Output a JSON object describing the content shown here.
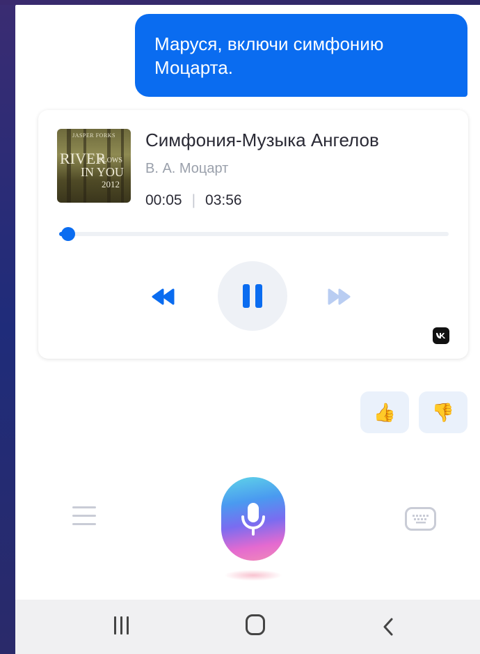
{
  "chat": {
    "user_message": {
      "line1": "Маруся, включи симфонию",
      "line2": "Моцарта."
    }
  },
  "player": {
    "cover_art": {
      "label_top": "JASPER FORKS",
      "word_river": "RIVER",
      "word_flows": "FLOWS",
      "word_in_you": "IN YOU",
      "year": "2012"
    },
    "title": "Симфония-Музыка Ангелов",
    "artist": "В. А. Моцарт",
    "elapsed": "00:05",
    "separator": "|",
    "duration": "03:56",
    "progress": 0.02,
    "state": "playing",
    "source_badge": "vk"
  },
  "feedback": {
    "like_emoji": "👍",
    "dislike_emoji": "👎"
  },
  "bottom_bar": {
    "menu_icon": "menu-icon",
    "mic_icon": "microphone-icon",
    "keyboard_icon": "keyboard-icon"
  },
  "system_nav": {
    "recents_icon": "recents-icon",
    "home_icon": "home-icon",
    "back_icon": "back-icon"
  },
  "colors": {
    "accent": "#0a6cf0",
    "text_primary": "#2a2a35",
    "text_secondary": "#9aa0ab"
  }
}
